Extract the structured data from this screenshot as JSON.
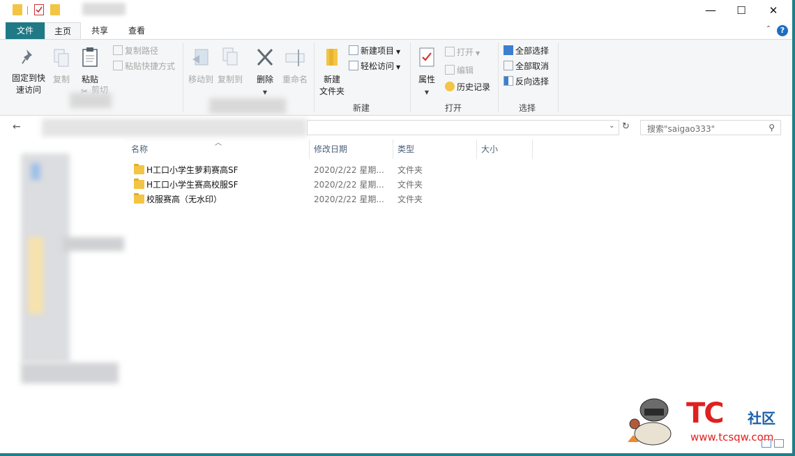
{
  "window": {
    "minimize_symbol": "—",
    "maximize_symbol": "☐",
    "close_symbol": "✕"
  },
  "tabs": {
    "file": "文件",
    "home": "主页",
    "share": "共享",
    "view": "查看"
  },
  "ribbon": {
    "clipboard": {
      "pin_line1": "固定到快",
      "pin_line2": "速访问",
      "copy": "复制",
      "paste": "粘贴",
      "copy_path": "复制路径",
      "paste_shortcut": "粘贴快捷方式",
      "cut": "剪切"
    },
    "organize": {
      "move_to": "移动到",
      "copy_to": "复制到",
      "delete": "删除",
      "rename": "重命名"
    },
    "new_group": {
      "new_folder_line1": "新建",
      "new_folder_line2": "文件夹",
      "new_item": "新建项目",
      "easy_access": "轻松访问",
      "label": "新建"
    },
    "open_group": {
      "properties": "属性",
      "open": "打开",
      "edit": "编辑",
      "history": "历史记录",
      "label": "打开"
    },
    "select_group": {
      "select_all": "全部选择",
      "select_none": "全部取消",
      "invert": "反向选择",
      "label": "选择"
    }
  },
  "search": {
    "placeholder": "搜索\"saigao333\""
  },
  "columns": {
    "name": "名称",
    "date": "修改日期",
    "type": "类型",
    "size": "大小"
  },
  "files": [
    {
      "name": "H工口小学生萝莉赛高SF",
      "date": "2020/2/22 星期...",
      "type": "文件夹"
    },
    {
      "name": "H工口小学生赛高校服SF",
      "date": "2020/2/22 星期...",
      "type": "文件夹"
    },
    {
      "name": "校服赛高（无水印）",
      "date": "2020/2/22 星期...",
      "type": "文件夹"
    }
  ],
  "watermark": {
    "brand": "TC",
    "community": "社区",
    "url": "www.tcsqw.com"
  },
  "colors": {
    "file_tab": "#1f7a86",
    "folder": "#f3c544",
    "watermark_red": "#e0201f",
    "watermark_blue": "#1a5fa8"
  }
}
